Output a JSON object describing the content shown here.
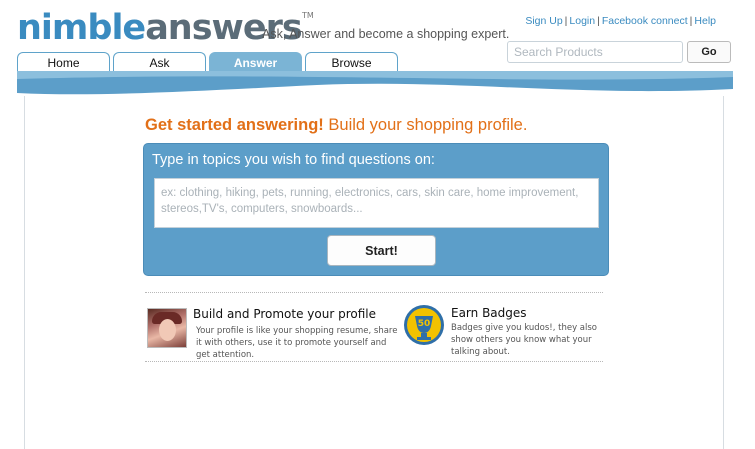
{
  "header": {
    "logo_part1": "nimble",
    "logo_part2": "answers",
    "logo_tm": "TM",
    "tagline": "Ask, Answer and become a shopping expert.",
    "links": [
      "Sign Up",
      "Login",
      "Facebook connect",
      "Help"
    ],
    "search_placeholder": "Search Products",
    "go_label": "Go"
  },
  "nav": {
    "tabs": [
      {
        "label": "Home",
        "active": false
      },
      {
        "label": "Ask",
        "active": false
      },
      {
        "label": "Answer",
        "active": true
      },
      {
        "label": "Browse",
        "active": false
      }
    ]
  },
  "main": {
    "headline_bold": "Get started answering!",
    "headline_rest": " Build your shopping profile.",
    "panel_title": "Type in topics you wish to find questions on:",
    "topics_placeholder": "ex: clothing, hiking, pets, running, electronics, cars, skin care, home improvement, stereos,TV's, computers, snowboards...",
    "start_label": "Start!"
  },
  "features": [
    {
      "title": "Build and Promote your profile",
      "desc": "Your profile is like your shopping resume, share it with others, use it to promote yourself and get attention."
    },
    {
      "title": "Earn Badges",
      "desc": "Badges give you kudos!, they also show others you know what your talking about."
    }
  ],
  "badge_number": "50",
  "colors": {
    "brand_blue": "#3a8bc0",
    "panel_blue": "#5c9ec9",
    "headline_orange": "#e27018",
    "tab_active": "#7bb4d5"
  }
}
